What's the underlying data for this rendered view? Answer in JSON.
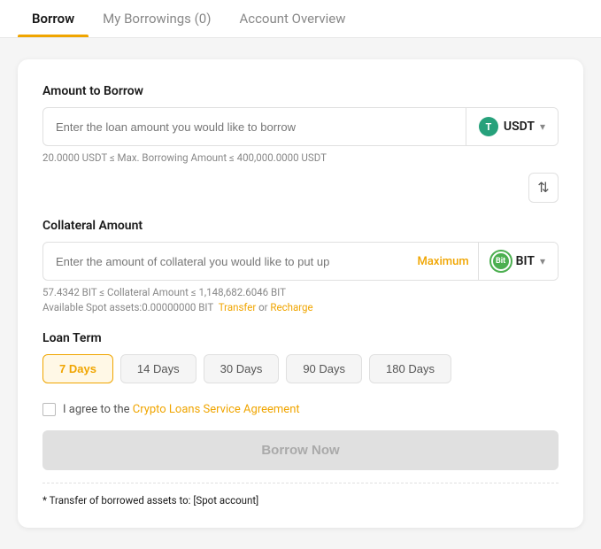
{
  "tabs": [
    {
      "id": "borrow",
      "label": "Borrow",
      "active": true
    },
    {
      "id": "my-borrowings",
      "label": "My Borrowings (0)",
      "active": false
    },
    {
      "id": "account-overview",
      "label": "Account Overview",
      "active": false
    }
  ],
  "borrow_section": {
    "amount_label": "Amount to Borrow",
    "amount_placeholder": "Enter the loan amount you would like to borrow",
    "amount_currency_icon": "T",
    "amount_currency_name": "USDT",
    "amount_hint": "20.0000 USDT ≤ Max. Borrowing Amount ≤ 400,000.0000 USDT",
    "swap_icon": "⇅",
    "collateral_label": "Collateral Amount",
    "collateral_placeholder": "Enter the amount of collateral you would like to put up",
    "maximum_label": "Maximum",
    "collateral_currency_icon": "Bit",
    "collateral_currency_name": "BIT",
    "collateral_hint": "57.4342 BIT ≤ Collateral Amount ≤ 1,148,682.6046 BIT",
    "available_spot_label": "Available Spot assets:",
    "available_spot_value": "0.00000000 BIT",
    "transfer_label": "Transfer",
    "or_label": "or",
    "recharge_label": "Recharge",
    "loan_term_label": "Loan Term",
    "loan_terms": [
      {
        "label": "7 Days",
        "value": "7",
        "active": true
      },
      {
        "label": "14 Days",
        "value": "14",
        "active": false
      },
      {
        "label": "30 Days",
        "value": "30",
        "active": false
      },
      {
        "label": "90 Days",
        "value": "90",
        "active": false
      },
      {
        "label": "180 Days",
        "value": "180",
        "active": false
      }
    ],
    "agreement_text_before": "I agree to the ",
    "agreement_link_label": "Crypto Loans Service Agreement",
    "borrow_button_label": "Borrow Now",
    "footer_note_prefix": "* Transfer of borrowed assets to: ",
    "footer_note_value": "[Spot account]"
  }
}
